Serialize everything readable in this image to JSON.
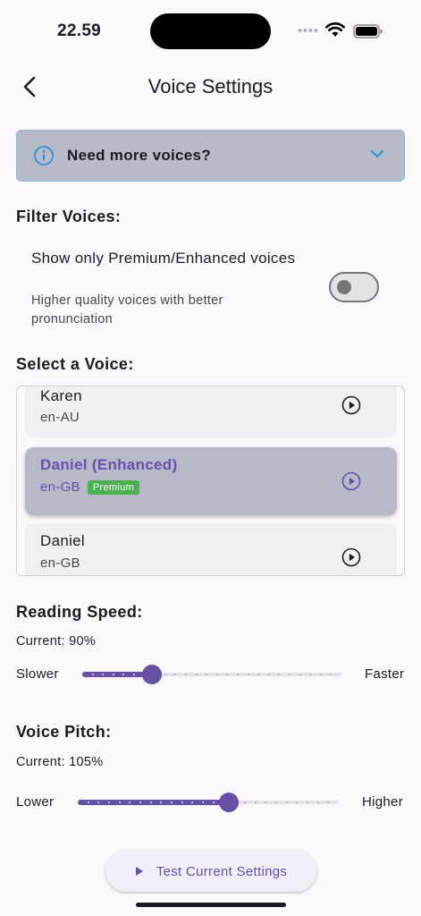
{
  "status_bar": {
    "time": "22.59"
  },
  "header": {
    "title": "Voice Settings"
  },
  "info_banner": {
    "text": "Need more voices?"
  },
  "filter": {
    "section_title": "Filter Voices:",
    "option_title": "Show only Premium/Enhanced voices",
    "option_subtitle": "Higher quality voices with better pronunciation",
    "enabled": false
  },
  "voices": {
    "section_title": "Select a Voice:",
    "items": [
      {
        "name": "Karen",
        "locale": "en-AU",
        "badge": ""
      },
      {
        "name": "Daniel (Enhanced)",
        "locale": "en-GB",
        "badge": "Premium",
        "selected": true
      },
      {
        "name": "Daniel",
        "locale": "en-GB",
        "badge": ""
      }
    ]
  },
  "reading_speed": {
    "section_title": "Reading Speed:",
    "current": "Current: 90%",
    "min_label": "Slower",
    "max_label": "Faster",
    "fraction": 0.27
  },
  "voice_pitch": {
    "section_title": "Voice Pitch:",
    "current": "Current: 105%",
    "min_label": "Lower",
    "max_label": "Higher",
    "fraction": 0.58
  },
  "test_button": {
    "label": "Test Current Settings"
  },
  "colors": {
    "accent": "#6750a4",
    "premium_badge": "#4caf50",
    "banner_bg": "#b7bac7"
  }
}
